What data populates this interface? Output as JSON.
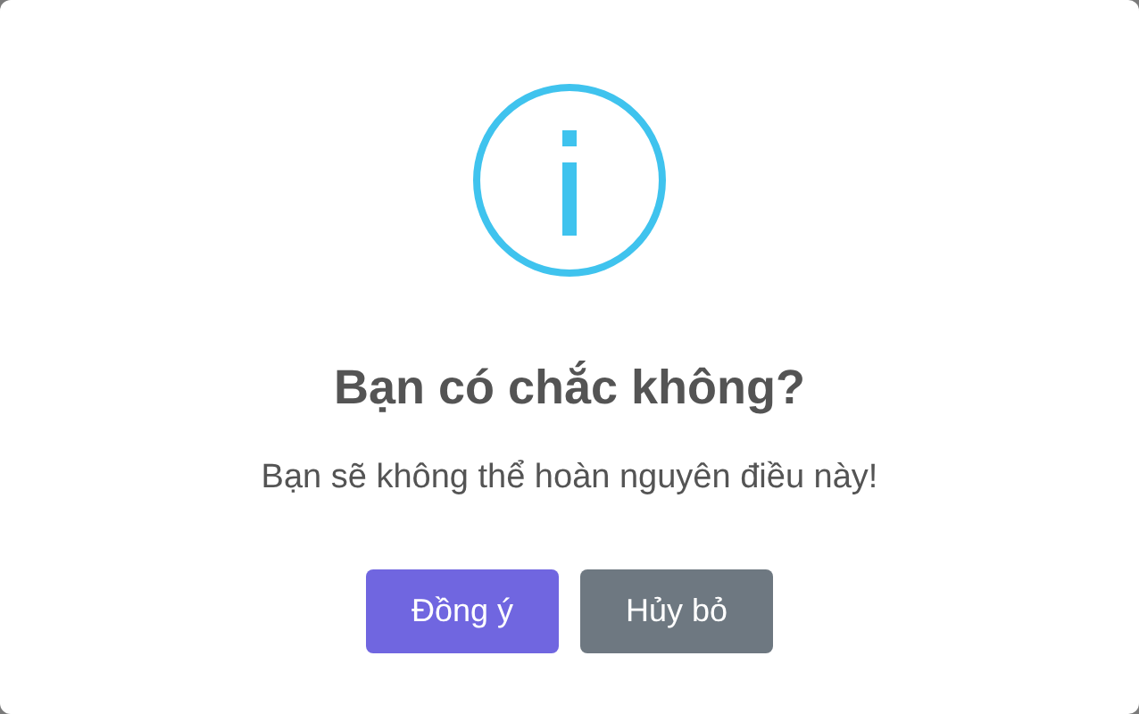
{
  "dialog": {
    "title": "Bạn có chắc không?",
    "message": "Bạn sẽ không thể hoàn nguyên điều này!",
    "buttons": [
      {
        "label": "Đồng ý",
        "kind": "confirm"
      },
      {
        "label": "Hủy bỏ",
        "kind": "cancel"
      }
    ]
  }
}
